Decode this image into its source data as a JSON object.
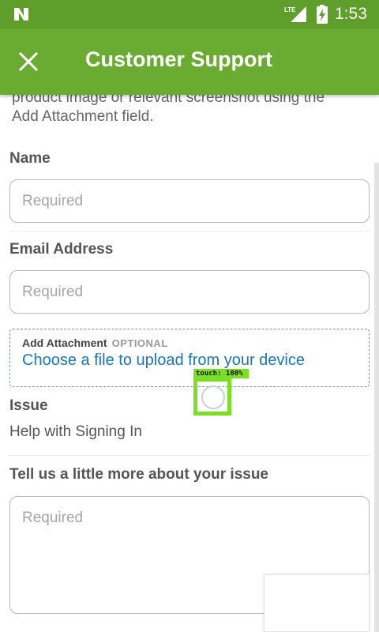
{
  "status_bar": {
    "network": "LTE",
    "time": "1:53",
    "icons": [
      "nougat-logo-icon",
      "signal-icon",
      "battery-charging-icon"
    ]
  },
  "app_bar": {
    "title": "Customer Support",
    "close_icon": "close-icon"
  },
  "intro_text": "product image or relevant screenshot using the Add Attachment field.",
  "form": {
    "name": {
      "label": "Name",
      "placeholder": "Required",
      "value": ""
    },
    "email": {
      "label": "Email Address",
      "placeholder": "Required",
      "value": ""
    },
    "attachment": {
      "label": "Add Attachment",
      "optional": "OPTIONAL",
      "link": "Choose a file to upload from your device"
    },
    "issue": {
      "label": "Issue",
      "value": "Help with Signing In"
    },
    "details": {
      "label": "Tell us a little more about your issue",
      "placeholder": "Required",
      "value": ""
    }
  },
  "overlay": {
    "touch_label": "touch: 100%"
  },
  "colors": {
    "status_bar": "#5f9e2a",
    "app_bar": "#6aac32",
    "link": "#1976b8",
    "touch_marker": "#7be021"
  }
}
